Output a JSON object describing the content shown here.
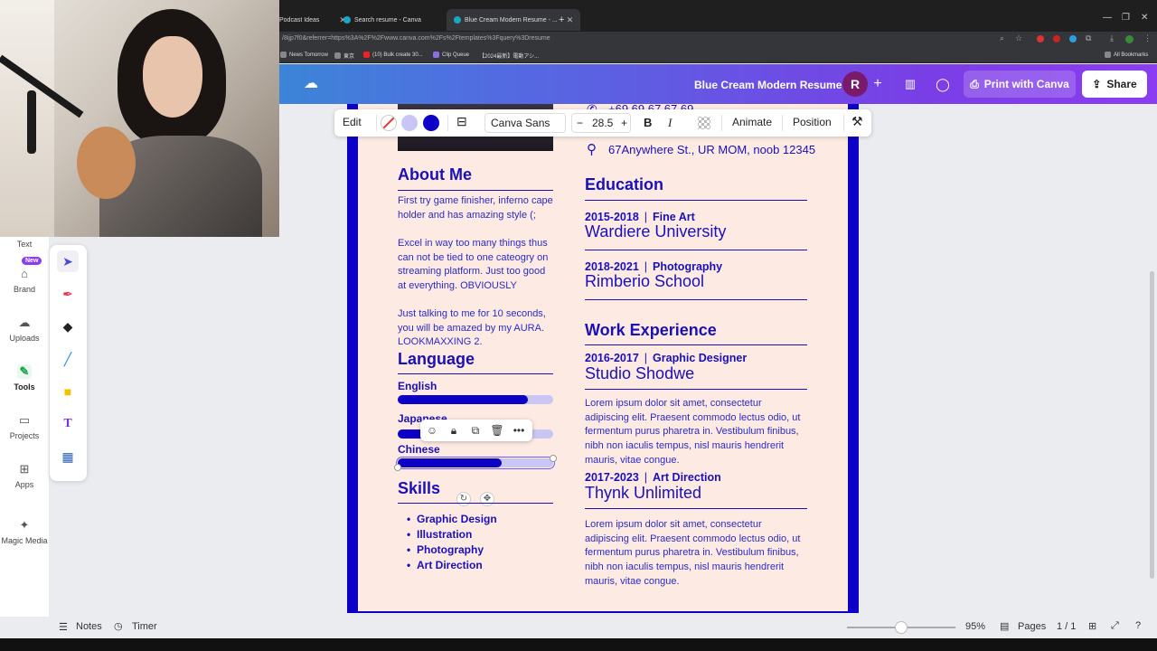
{
  "browser": {
    "tabs": [
      {
        "label": "Podcast Ideas"
      },
      {
        "label": "Search resume - Canva"
      },
      {
        "label": "Blue Cream Modern Resume - ..."
      }
    ],
    "new_tab_icon": "plus-icon",
    "url": "/8ijp7f0&referrer=https%3A%2F%2Fwww.canva.com%2Fs%2Ftemplates%3Fquery%3Dresume",
    "bookmarks": [
      {
        "label": "News Tomorrow"
      },
      {
        "label": "東京"
      },
      {
        "label": "(10) Bulk create 30..."
      },
      {
        "label": "Clip Queue"
      },
      {
        "label": "【2024最新】電動アシ..."
      }
    ],
    "all_bookmarks": "All Bookmarks"
  },
  "header": {
    "title": "Blue Cream Modern Resume",
    "avatar_letter": "R",
    "print_label": "Print with Canva",
    "share_label": "Share"
  },
  "leftrail": {
    "items": [
      {
        "label": "Text",
        "icon": "text-icon"
      },
      {
        "label": "Brand",
        "icon": "brand-icon"
      },
      {
        "label": "Uploads",
        "icon": "cloud-upload-icon"
      },
      {
        "label": "Tools",
        "icon": "tools-icon"
      },
      {
        "label": "Projects",
        "icon": "folder-icon"
      },
      {
        "label": "Apps",
        "icon": "apps-icon"
      },
      {
        "label": "Magic Media",
        "icon": "magic-media-icon"
      }
    ],
    "new_badge": "New"
  },
  "text_toolbar": {
    "edit": "Edit",
    "font": "Canva Sans",
    "minus": "−",
    "size": "28.5",
    "plus": "+",
    "bold": "B",
    "italic": "I",
    "animate": "Animate",
    "position": "Position"
  },
  "resume": {
    "address": "67Anywhere St., UR MOM, noob 12345",
    "phone_partial": "+69 69 67 67 69",
    "about": {
      "title": "About Me",
      "p1": "First try game finisher, inferno cape holder and has amazing style (;",
      "p2": "Excel in way too many things thus can not be tied to one cateogry on streaming platform. Just too good at everything. OBVIOUSLY",
      "p3": "Just talking to me for 10 seconds, you will be amazed by my AURA. LOOKMAXXING 2."
    },
    "language": {
      "title": "Language",
      "items": [
        {
          "name": "English",
          "level": 0.84
        },
        {
          "name": "Japanese",
          "level": 0.33
        },
        {
          "name": "Chinese",
          "level": 0.67
        }
      ]
    },
    "skills": {
      "title": "Skills",
      "items": [
        "Graphic Design",
        "Illustration",
        "Photography",
        "Art Direction"
      ]
    },
    "education": {
      "title": "Education",
      "entries": [
        {
          "years": "2015-2018",
          "field": "Fine Art",
          "school": "Wardiere University"
        },
        {
          "years": "2018-2021",
          "field": "Photography",
          "school": "Rimberio School"
        }
      ]
    },
    "work": {
      "title": "Work Experience",
      "entries": [
        {
          "years": "2016-2017",
          "role": "Graphic Designer",
          "company": "Studio Shodwe",
          "desc": "Lorem ipsum dolor sit amet, consectetur adipiscing elit. Praesent commodo lectus odio, ut fermentum purus pharetra in. Vestibulum finibus, nibh non iaculis tempus, nisl mauris hendrerit mauris, vitae congue."
        },
        {
          "years": "2017-2023",
          "role": "Art Direction",
          "company": "Thynk Unlimited",
          "desc": "Lorem ipsum dolor sit amet, consectetur adipiscing elit. Praesent commodo lectus odio, ut fermentum purus pharetra in. Vestibulum finibus, nibh non iaculis tempus, nisl mauris hendrerit mauris, vitae congue."
        }
      ]
    }
  },
  "bottom": {
    "notes": "Notes",
    "timer": "Timer",
    "zoom": "95%",
    "pages_label": "Pages",
    "page_count": "1 / 1",
    "zoom_level": 0.5
  },
  "colors": {
    "accent": "#0d00c7",
    "page_bg": "#fdeae3",
    "header_gradient_start": "#1ea7c9",
    "header_gradient_end": "#8b3df0"
  }
}
